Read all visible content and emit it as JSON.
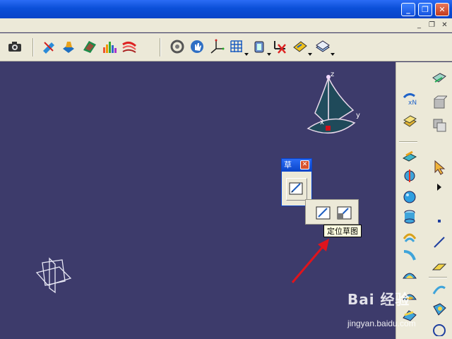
{
  "window": {
    "controls": [
      "_",
      "❐",
      "✕"
    ],
    "sub_controls": [
      "_",
      "❐",
      "✕"
    ]
  },
  "toolbar": {
    "icons": [
      "camera-icon",
      "cut-view-icon",
      "compass-sketch-icon",
      "surface-icon",
      "analysis-histogram-icon",
      "curvature-icon",
      "rotate-icon",
      "hand-pan-icon",
      "axis-icon",
      "grid-icon",
      "snap-icon",
      "constraint-icon",
      "view-icon",
      "layer-icon"
    ]
  },
  "sketch_window": {
    "title": "草",
    "close": "✕"
  },
  "popout": {
    "tools": [
      "sketch-icon",
      "positioned-sketch-icon"
    ]
  },
  "tooltip": {
    "text": "定位草图"
  },
  "compass": {
    "axis_z": "z",
    "axis_x": "x",
    "axis_y": "y"
  },
  "watermark": {
    "logo": "Bai 经验",
    "url": "jingyan.baidu.com"
  },
  "colors": {
    "viewport_bg": "#3d3b6b",
    "title_blue": "#0a44c8",
    "arrow_red": "#e0141c"
  }
}
